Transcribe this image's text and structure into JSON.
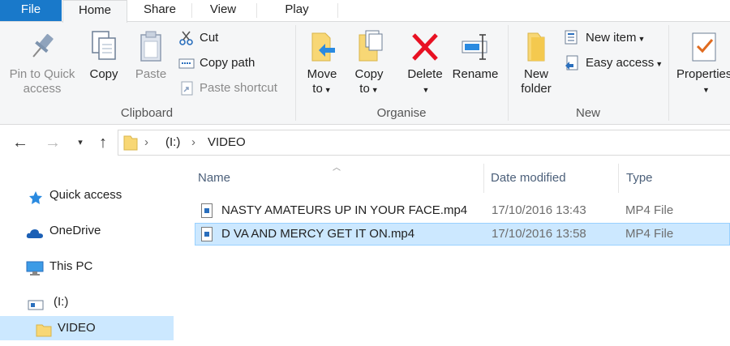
{
  "tabs": {
    "file": "File",
    "home": "Home",
    "share": "Share",
    "view": "View",
    "play": "Play"
  },
  "ribbon": {
    "clipboard": {
      "group_label": "Clipboard",
      "pin_line1": "Pin to Quick",
      "pin_line2": "access",
      "copy": "Copy",
      "paste": "Paste",
      "cut": "Cut",
      "copy_path": "Copy path",
      "paste_shortcut": "Paste shortcut"
    },
    "organise": {
      "group_label": "Organise",
      "move_line1": "Move",
      "move_line2": "to",
      "copy_line1": "Copy",
      "copy_line2": "to",
      "delete": "Delete",
      "rename": "Rename"
    },
    "new": {
      "group_label": "New",
      "folder_line1": "New",
      "folder_line2": "folder",
      "new_item": "New item",
      "easy_access": "Easy access"
    },
    "open": {
      "properties": "Properties"
    }
  },
  "address": {
    "drive": "(I:)",
    "folder": "VIDEO"
  },
  "navpane": {
    "quick_access": "Quick access",
    "onedrive": "OneDrive",
    "this_pc": "This PC",
    "drive": "(I:)",
    "video": "VIDEO"
  },
  "columns": {
    "name": "Name",
    "date": "Date modified",
    "type": "Type"
  },
  "files": [
    {
      "name": "NASTY AMATEURS UP IN YOUR FACE.mp4",
      "date": "17/10/2016 13:43",
      "type": "MP4 File"
    },
    {
      "name": "D VA AND MERCY GET IT ON.mp4",
      "date": "17/10/2016 13:58",
      "type": "MP4 File"
    }
  ],
  "colors": {
    "accent": "#1979ca",
    "selection": "#cce8ff",
    "folder": "#f8d775",
    "delete_red": "#e81123"
  }
}
